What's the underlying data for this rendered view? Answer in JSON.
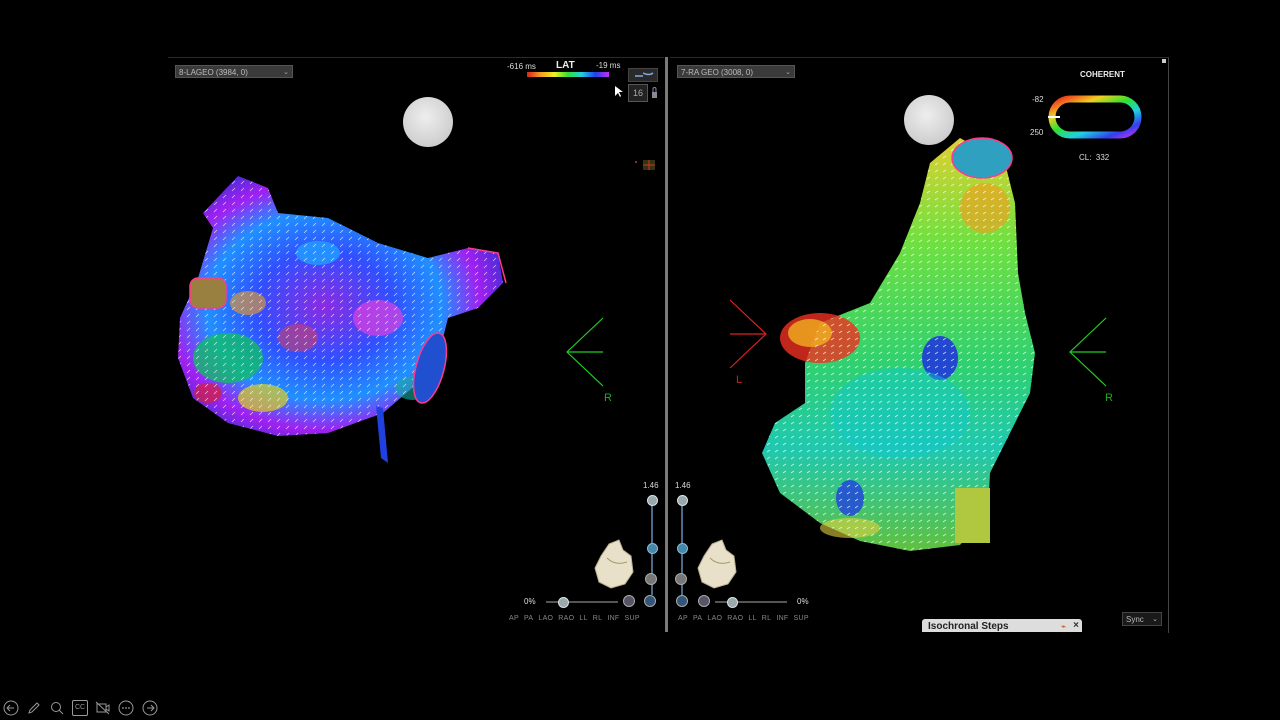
{
  "left_map": {
    "select_label": "8-LAGEO (3984, 0)",
    "lat_label": "LAT",
    "lat_min": "-616 ms",
    "lat_max": "-19 ms",
    "count_badge": "16",
    "orientation_letter": "R",
    "zoom_value": "1.46",
    "opacity_value": "0%",
    "view_buttons": [
      "AP",
      "PA",
      "LAO",
      "RAO",
      "LL",
      "RL",
      "INF",
      "SUP"
    ]
  },
  "right_map": {
    "select_label": "7-RA GEO (3008, 0)",
    "coherent_label": "COHERENT",
    "scale_top": "-82",
    "scale_bottom": "250",
    "cl_label": "CL:",
    "cl_value": "332",
    "orientation_left_letter": "L",
    "orientation_right_letter": "R",
    "zoom_value": "1.46",
    "opacity_value": "0%",
    "view_buttons": [
      "AP",
      "PA",
      "LAO",
      "RAO",
      "LL",
      "RL",
      "INF",
      "SUP"
    ],
    "sync_label": "Sync"
  },
  "isochronal": {
    "title": "Isochronal Steps",
    "close": "×"
  },
  "player_toolbar": {
    "icons": [
      "back-arrow-icon",
      "pen-icon",
      "zoom-icon",
      "captions-icon",
      "camera-off-icon",
      "more-icon",
      "forward-arrow-icon"
    ],
    "captions_text": "CC"
  },
  "colors": {
    "panel_bg": "#000000",
    "divider": "#7a7a7a",
    "orientation_green": "#22cc22",
    "orientation_red": "#dd2222"
  }
}
